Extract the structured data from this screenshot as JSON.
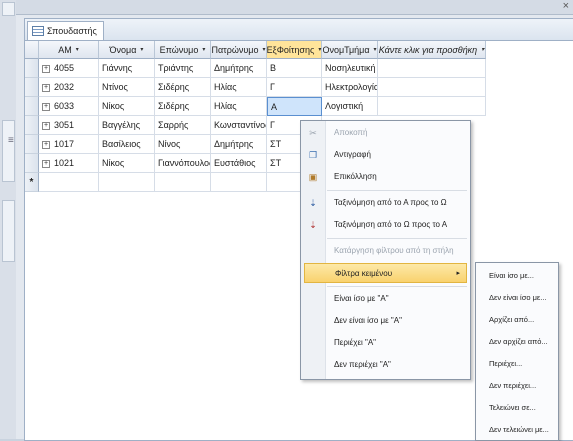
{
  "tab": {
    "label": "Σπουδαστής"
  },
  "columns": [
    {
      "label": "ΑΜ",
      "arrow": "▾"
    },
    {
      "label": "Όνομα",
      "arrow": "▾"
    },
    {
      "label": "Επώνυμο",
      "arrow": "▾"
    },
    {
      "label": "Πατρώνυμο",
      "arrow": "▾"
    },
    {
      "label": "ΕξΦοίτησης",
      "arrow": "▾"
    },
    {
      "label": "ΟνομΤμήμα",
      "arrow": "▾"
    },
    {
      "label": "Κάντε κλικ για προσθήκη",
      "arrow": "▾"
    }
  ],
  "rows": [
    {
      "am": "4055",
      "onoma": "Γιάννης",
      "eponymo": "Τριάντης",
      "patronymo": "Δημήτρης",
      "exam": "Β",
      "tmima": "Νοσηλευτική"
    },
    {
      "am": "2032",
      "onoma": "Ντίνος",
      "eponymo": "Σιδέρης",
      "patronymo": "Ηλίας",
      "exam": "Γ",
      "tmima": "Ηλεκτρολογία"
    },
    {
      "am": "6033",
      "onoma": "Νίκος",
      "eponymo": "Σιδέρης",
      "patronymo": "Ηλίας",
      "exam": "Α",
      "tmima": "Λογιστική"
    },
    {
      "am": "3051",
      "onoma": "Βαγγέλης",
      "eponymo": "Σαρρής",
      "patronymo": "Κωνσταντίνος",
      "exam": "Γ",
      "tmima": ""
    },
    {
      "am": "1017",
      "onoma": "Βασίλειος",
      "eponymo": "Νίνος",
      "patronymo": "Δημήτρης",
      "exam": "ΣΤ",
      "tmima": ""
    },
    {
      "am": "1021",
      "onoma": "Νίκος",
      "eponymo": "Γιαννόπουλος",
      "patronymo": "Ευστάθιος",
      "exam": "ΣΤ",
      "tmima": ""
    }
  ],
  "new_row_marker": "*",
  "expand_glyph": "+",
  "context_menu": {
    "cut": "Αποκοπή",
    "copy": "Αντιγραφή",
    "paste": "Επικόλληση",
    "sort_asc": "Ταξινόμηση από το Α προς το Ω",
    "sort_desc": "Ταξινόμηση από το Ω προς το Α",
    "clear_filter": "Κατάργηση φίλτρου από τη στήλη ΕξΦοίτησης",
    "text_filters": "Φίλτρα κειμένου",
    "equals_a": "Είναι ίσο με \"Α\"",
    "not_equals_a": "Δεν είναι ίσο με \"Α\"",
    "contains_a": "Περιέχει \"Α\"",
    "not_contains_a": "Δεν περιέχει \"Α\"",
    "submenu_arrow": "▸"
  },
  "submenu": {
    "equals": "Είναι ίσο με...",
    "not_equals": "Δεν είναι ίσο με...",
    "begins_with": "Αρχίζει από...",
    "not_begins_with": "Δεν αρχίζει από...",
    "contains": "Περιέχει...",
    "not_contains": "Δεν περιέχει...",
    "ends_with": "Τελειώνει σε...",
    "not_ends_with": "Δεν τελειώνει με..."
  },
  "icons": {
    "close": "×",
    "grip": "≡"
  }
}
